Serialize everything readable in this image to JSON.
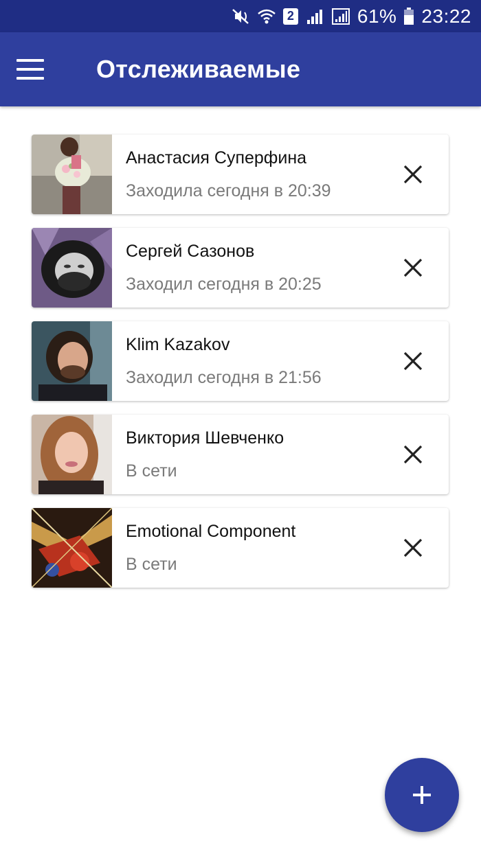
{
  "status_bar": {
    "battery": "61%",
    "time": "23:22",
    "sim_badge": "2",
    "icons": [
      "mute-icon",
      "wifi-icon",
      "sim-2-icon",
      "signal-icon",
      "signal-icon",
      "battery-icon"
    ]
  },
  "app_bar": {
    "title": "Отслеживаемые",
    "menu_icon": "hamburger-menu-icon"
  },
  "contacts": [
    {
      "name": "Анастасия Суперфина",
      "status": "Заходила сегодня в 20:39"
    },
    {
      "name": "Сергей Сазонов",
      "status": "Заходил сегодня в 20:25"
    },
    {
      "name": "Klim Kazakov",
      "status": "Заходил сегодня в 21:56"
    },
    {
      "name": "Виктория Шевченко",
      "status": "В сети"
    },
    {
      "name": "Emotional Component",
      "status": "В сети"
    }
  ],
  "fab": {
    "icon": "plus-icon"
  },
  "colors": {
    "status_bar": "#1f2d84",
    "app_bar": "#2f3f9e",
    "fab": "#2f3f9e",
    "secondary_text": "#7a7a7a"
  }
}
